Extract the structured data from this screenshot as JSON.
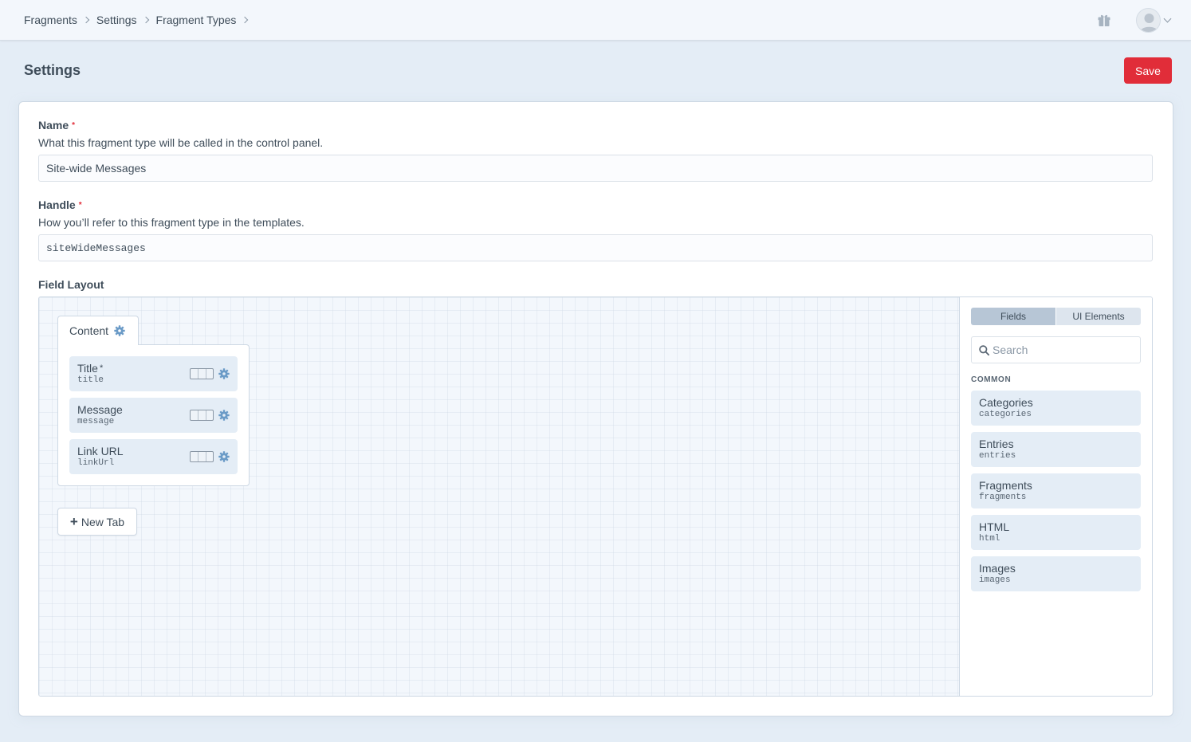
{
  "breadcrumb": [
    "Fragments",
    "Settings",
    "Fragment Types"
  ],
  "header": {
    "gift_icon": "gift-icon",
    "avatar_icon": "user-avatar-icon"
  },
  "page": {
    "title": "Settings",
    "save_label": "Save"
  },
  "colors": {
    "accent": "#e12d39",
    "bg": "#e4edf6",
    "gear": "#6b9bc7"
  },
  "form": {
    "name": {
      "label": "Name",
      "required": "*",
      "instructions": "What this fragment type will be called in the control panel.",
      "value": "Site-wide Messages"
    },
    "handle": {
      "label": "Handle",
      "required": "*",
      "instructions": "How you’ll refer to this fragment type in the templates.",
      "value": "siteWideMessages"
    }
  },
  "field_layout": {
    "label": "Field Layout",
    "tabs": [
      {
        "name": "Content",
        "fields": [
          {
            "name": "Title",
            "required_marker": "*",
            "handle": "title"
          },
          {
            "name": "Message",
            "required_marker": "",
            "handle": "message"
          },
          {
            "name": "Link URL",
            "required_marker": "",
            "handle": "linkUrl"
          }
        ]
      }
    ],
    "new_tab_label": "New Tab",
    "sidebar": {
      "tabs": [
        "Fields",
        "UI Elements"
      ],
      "active_tab": "Fields",
      "search_placeholder": "Search",
      "group_title": "COMMON",
      "items": [
        {
          "name": "Categories",
          "handle": "categories"
        },
        {
          "name": "Entries",
          "handle": "entries"
        },
        {
          "name": "Fragments",
          "handle": "fragments"
        },
        {
          "name": "HTML",
          "handle": "html"
        },
        {
          "name": "Images",
          "handle": "images"
        }
      ]
    }
  }
}
